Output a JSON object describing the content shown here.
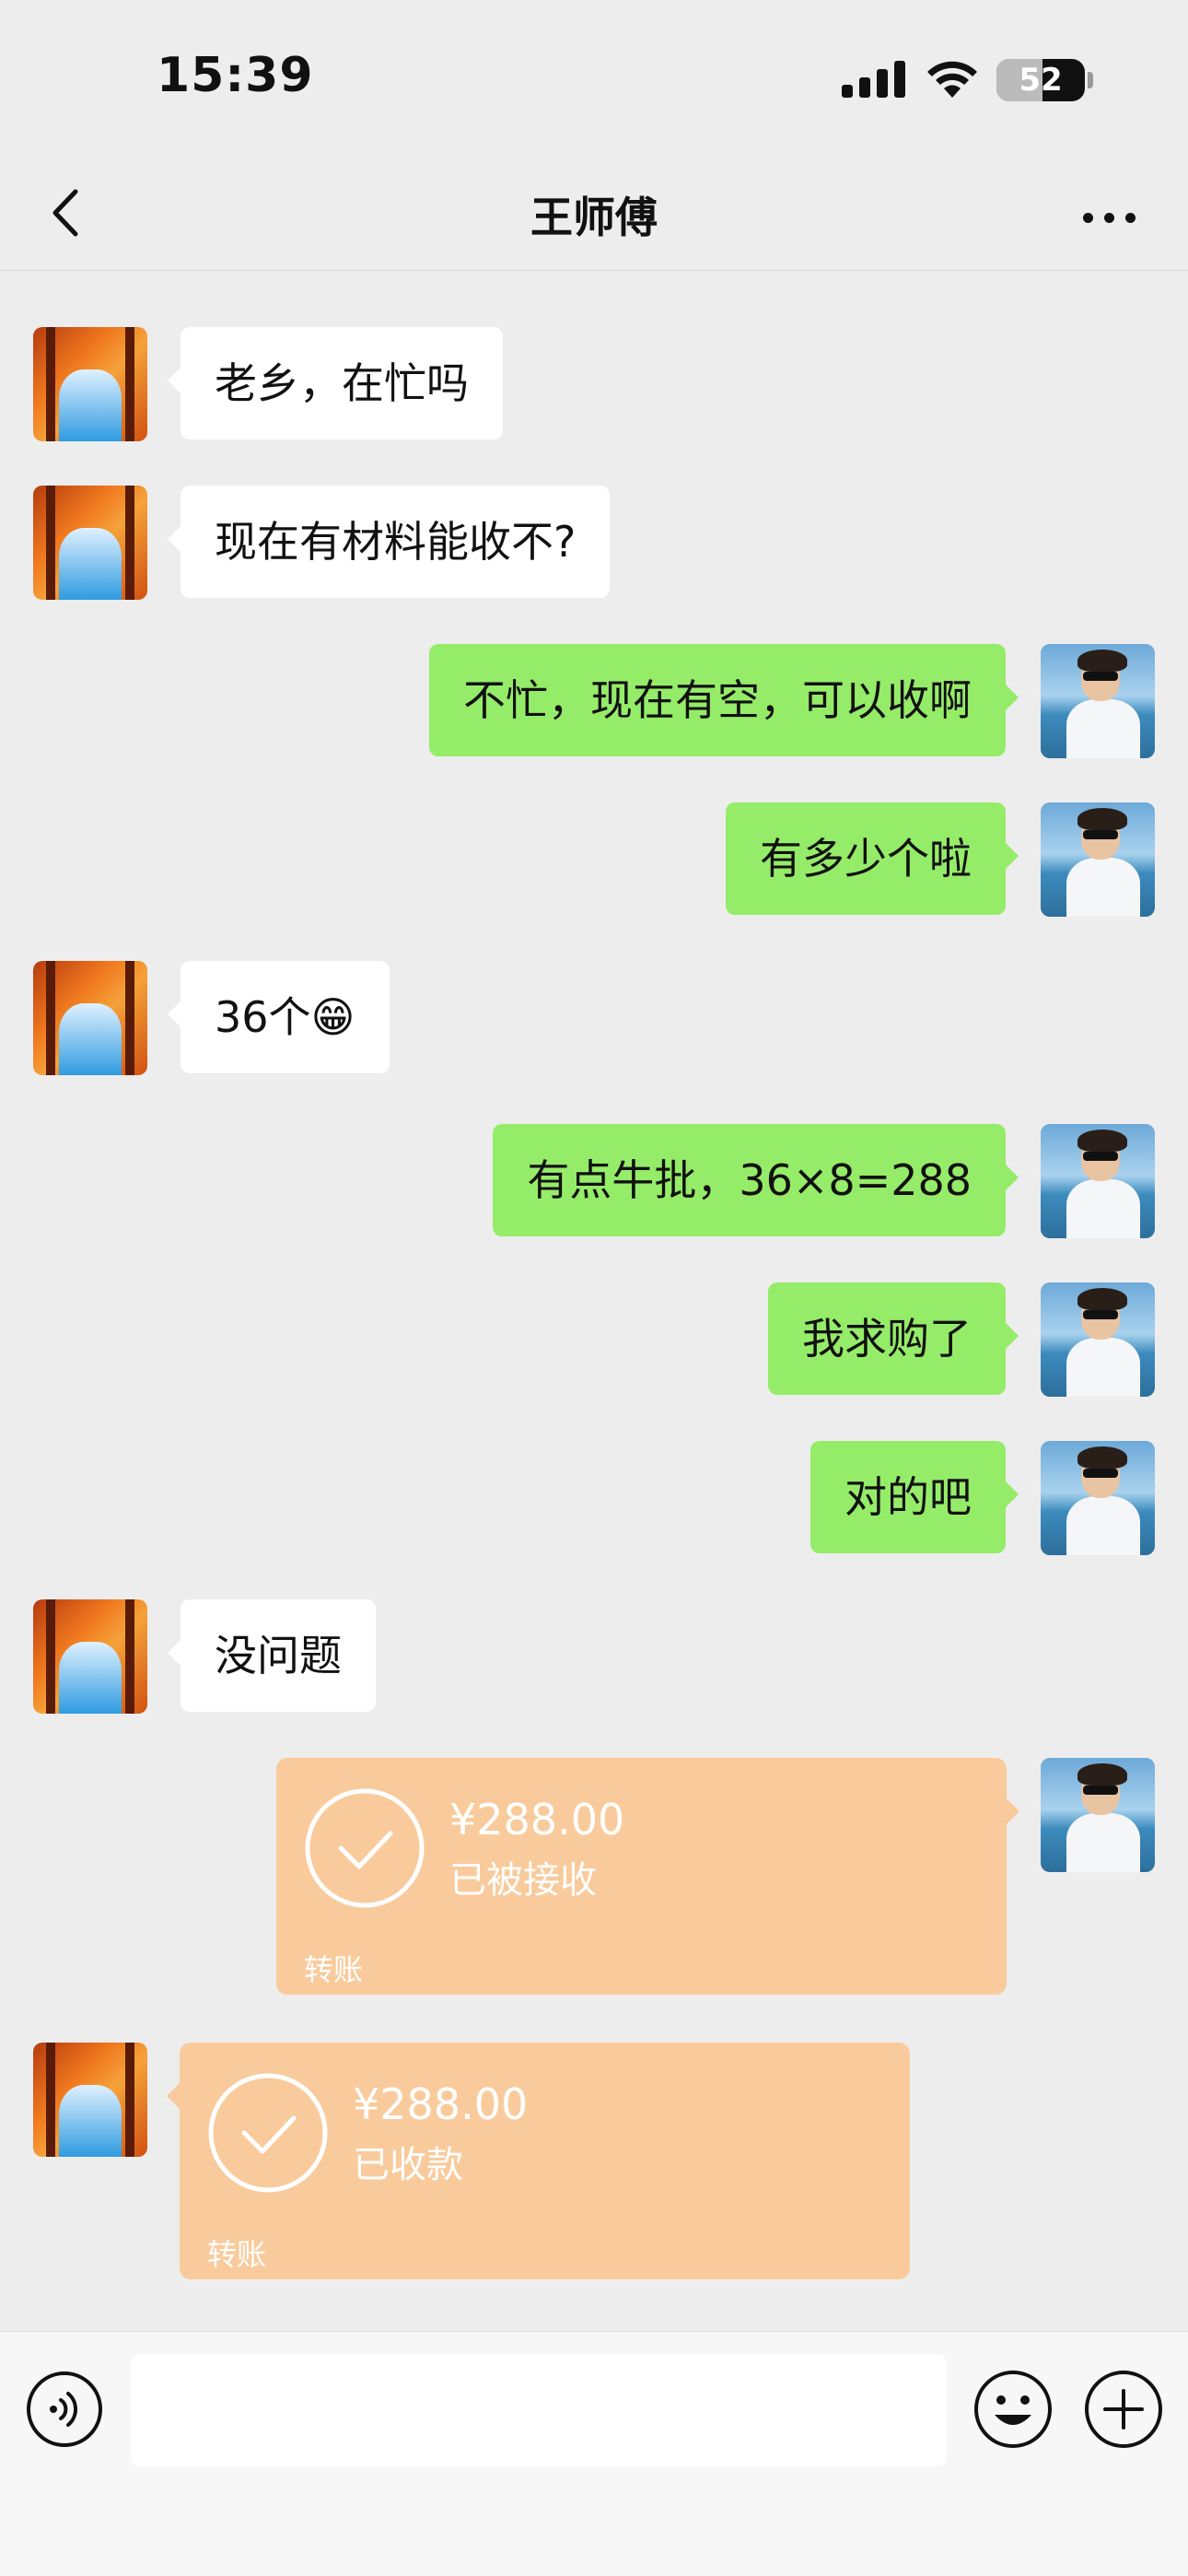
{
  "status_bar": {
    "time": "15:39",
    "battery_percent": "52",
    "battery_level": 0.52
  },
  "nav": {
    "title": "王师傅",
    "back_icon": "chevron-left-icon",
    "more_icon": "ellipsis-icon"
  },
  "messages": [
    {
      "side": "left",
      "kind": "text",
      "text": "老乡，在忙吗"
    },
    {
      "side": "left",
      "kind": "text",
      "text": "现在有材料能收不?"
    },
    {
      "side": "right",
      "kind": "text",
      "text": "不忙，现在有空，可以收啊"
    },
    {
      "side": "right",
      "kind": "text",
      "text": "有多少个啦"
    },
    {
      "side": "left",
      "kind": "text",
      "text": "36个😁"
    },
    {
      "side": "right",
      "kind": "text",
      "text": "有点牛批，36×8=288"
    },
    {
      "side": "right",
      "kind": "text",
      "text": "我求购了"
    },
    {
      "side": "right",
      "kind": "text",
      "text": "对的吧"
    },
    {
      "side": "left",
      "kind": "text",
      "text": "没问题"
    },
    {
      "side": "right",
      "kind": "transfer",
      "amount": "¥288.00",
      "status": "已被接收",
      "label": "转账"
    },
    {
      "side": "left",
      "kind": "transfer",
      "amount": "¥288.00",
      "status": "已收款",
      "label": "转账"
    }
  ],
  "input_bar": {
    "placeholder": "",
    "voice_icon": "voice-icon",
    "emoji_icon": "emoji-icon",
    "plus_icon": "plus-icon"
  },
  "colors": {
    "background": "#ededed",
    "bubble_in": "#ffffff",
    "bubble_out": "#95ec69",
    "transfer": "#f9cb9c"
  }
}
